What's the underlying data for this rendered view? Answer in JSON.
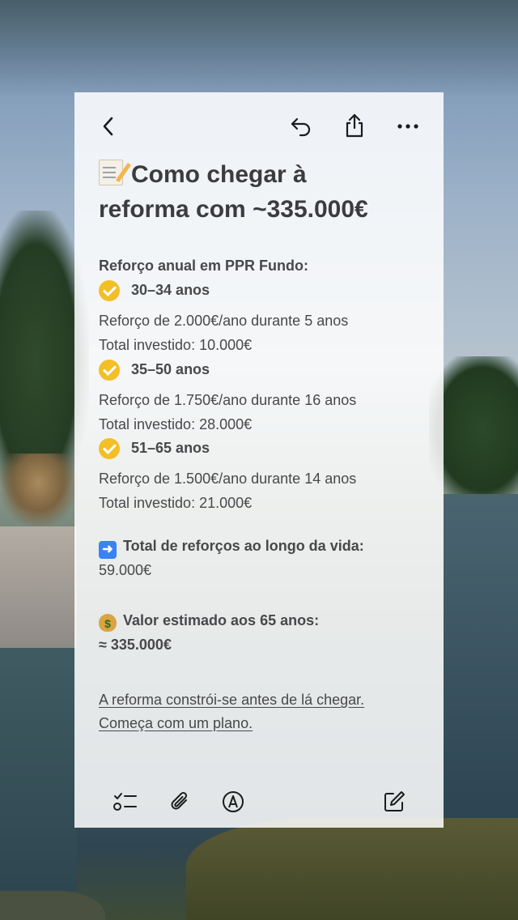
{
  "note": {
    "title_line1": "Como chegar à",
    "title_line2": "reforma com ~335.000€",
    "section_header": "Reforço anual em PPR Fundo:",
    "brackets": [
      {
        "age_range": "30–34 anos",
        "contribution": "Reforço de 2.000€/ano durante 5 anos",
        "total": "Total investido: 10.000€"
      },
      {
        "age_range": "35–50 anos",
        "contribution": "Reforço de 1.750€/ano durante 16 anos",
        "total": "Total investido: 28.000€"
      },
      {
        "age_range": "51–65 anos",
        "contribution": "Reforço de 1.500€/ano durante 14 anos",
        "total": "Total investido: 21.000€"
      }
    ],
    "total_label": "Total de reforços ao longo da vida:",
    "total_value": "59.000€",
    "estimate_label": "Valor estimado aos 65 anos:",
    "estimate_value": "≈ 335.000€",
    "closing_line1": "A reforma constrói-se antes de lá chegar.",
    "closing_line2": "Começa com um plano."
  },
  "icons": {
    "back": "chevron-left-icon",
    "undo": "undo-icon",
    "share": "share-icon",
    "more": "more-icon",
    "checklist": "checklist-icon",
    "attach": "paperclip-icon",
    "markup": "markup-icon",
    "compose": "compose-icon"
  },
  "colors": {
    "check": "#f2bf27",
    "arrow_emoji": "#3a82f6",
    "text": "#48484a"
  }
}
